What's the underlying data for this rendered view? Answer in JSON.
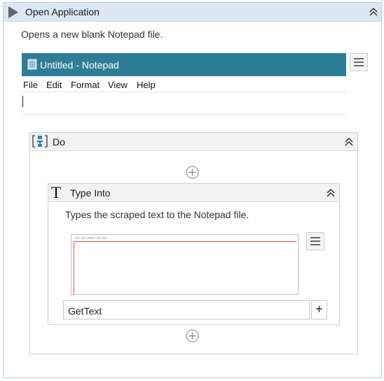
{
  "open_application": {
    "title": "Open Application",
    "description": "Opens a new blank Notepad file."
  },
  "notepad_preview": {
    "title": "Untitled - Notepad",
    "menu": [
      "File",
      "Edit",
      "Format",
      "View",
      "Help"
    ]
  },
  "do_sequence": {
    "title": "Do"
  },
  "type_into": {
    "title": "Type Into",
    "description": "Types the scraped text to the Notepad file.",
    "text_value": "GetText",
    "add_label": "+",
    "icon_glyph": "T"
  },
  "icons": {
    "header": "play-icon",
    "collapse": "chevron-double-up-icon",
    "menu": "hamburger-icon",
    "add": "add-circle-icon",
    "do": "sequence-icon",
    "notepad": "notepad-icon"
  },
  "colors": {
    "header_bg": "#dbe8f4",
    "notepad_titlebar": "#2e7d97",
    "selection_outline": "#d9534f"
  }
}
